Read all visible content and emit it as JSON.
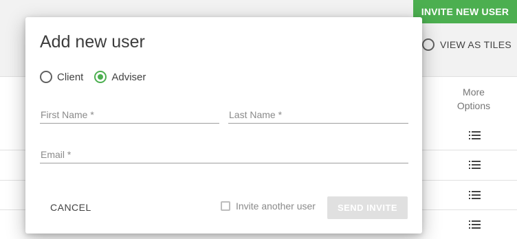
{
  "background": {
    "invite_new_user_label": "INVITE NEW USER",
    "view_as_tiles_label": "VIEW AS TILES",
    "more_options_header": "More Options",
    "row_count": 4,
    "row_icon": "list-icon"
  },
  "dialog": {
    "title": "Add new user",
    "role_options": [
      {
        "label": "Client",
        "selected": false
      },
      {
        "label": "Adviser",
        "selected": true
      }
    ],
    "fields": {
      "first_name": {
        "placeholder": "First Name *",
        "value": ""
      },
      "last_name": {
        "placeholder": "Last Name *",
        "value": ""
      },
      "email": {
        "placeholder": "Email *",
        "value": ""
      }
    },
    "cancel_label": "CANCEL",
    "invite_another_label": "Invite another user",
    "invite_another_checked": false,
    "send_invite_label": "SEND INVITE",
    "send_invite_enabled": false
  },
  "colors": {
    "accent": "#4caf50",
    "disabled_button": "#e0e0e0"
  }
}
